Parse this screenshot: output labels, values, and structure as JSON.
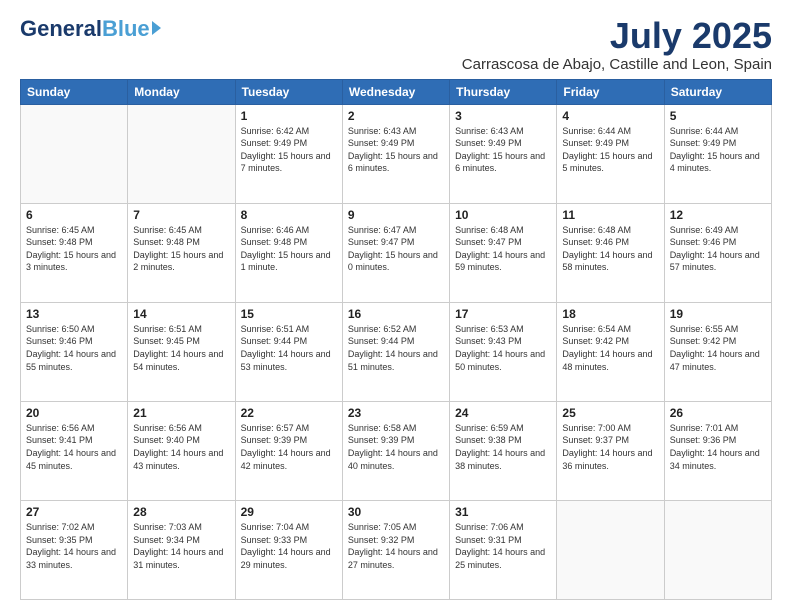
{
  "header": {
    "logo_general": "General",
    "logo_blue": "Blue",
    "main_title": "July 2025",
    "subtitle": "Carrascosa de Abajo, Castille and Leon, Spain"
  },
  "days_of_week": [
    "Sunday",
    "Monday",
    "Tuesday",
    "Wednesday",
    "Thursday",
    "Friday",
    "Saturday"
  ],
  "weeks": [
    [
      {
        "day": "",
        "info": ""
      },
      {
        "day": "",
        "info": ""
      },
      {
        "day": "1",
        "info": "Sunrise: 6:42 AM\nSunset: 9:49 PM\nDaylight: 15 hours and 7 minutes."
      },
      {
        "day": "2",
        "info": "Sunrise: 6:43 AM\nSunset: 9:49 PM\nDaylight: 15 hours and 6 minutes."
      },
      {
        "day": "3",
        "info": "Sunrise: 6:43 AM\nSunset: 9:49 PM\nDaylight: 15 hours and 6 minutes."
      },
      {
        "day": "4",
        "info": "Sunrise: 6:44 AM\nSunset: 9:49 PM\nDaylight: 15 hours and 5 minutes."
      },
      {
        "day": "5",
        "info": "Sunrise: 6:44 AM\nSunset: 9:49 PM\nDaylight: 15 hours and 4 minutes."
      }
    ],
    [
      {
        "day": "6",
        "info": "Sunrise: 6:45 AM\nSunset: 9:48 PM\nDaylight: 15 hours and 3 minutes."
      },
      {
        "day": "7",
        "info": "Sunrise: 6:45 AM\nSunset: 9:48 PM\nDaylight: 15 hours and 2 minutes."
      },
      {
        "day": "8",
        "info": "Sunrise: 6:46 AM\nSunset: 9:48 PM\nDaylight: 15 hours and 1 minute."
      },
      {
        "day": "9",
        "info": "Sunrise: 6:47 AM\nSunset: 9:47 PM\nDaylight: 15 hours and 0 minutes."
      },
      {
        "day": "10",
        "info": "Sunrise: 6:48 AM\nSunset: 9:47 PM\nDaylight: 14 hours and 59 minutes."
      },
      {
        "day": "11",
        "info": "Sunrise: 6:48 AM\nSunset: 9:46 PM\nDaylight: 14 hours and 58 minutes."
      },
      {
        "day": "12",
        "info": "Sunrise: 6:49 AM\nSunset: 9:46 PM\nDaylight: 14 hours and 57 minutes."
      }
    ],
    [
      {
        "day": "13",
        "info": "Sunrise: 6:50 AM\nSunset: 9:46 PM\nDaylight: 14 hours and 55 minutes."
      },
      {
        "day": "14",
        "info": "Sunrise: 6:51 AM\nSunset: 9:45 PM\nDaylight: 14 hours and 54 minutes."
      },
      {
        "day": "15",
        "info": "Sunrise: 6:51 AM\nSunset: 9:44 PM\nDaylight: 14 hours and 53 minutes."
      },
      {
        "day": "16",
        "info": "Sunrise: 6:52 AM\nSunset: 9:44 PM\nDaylight: 14 hours and 51 minutes."
      },
      {
        "day": "17",
        "info": "Sunrise: 6:53 AM\nSunset: 9:43 PM\nDaylight: 14 hours and 50 minutes."
      },
      {
        "day": "18",
        "info": "Sunrise: 6:54 AM\nSunset: 9:42 PM\nDaylight: 14 hours and 48 minutes."
      },
      {
        "day": "19",
        "info": "Sunrise: 6:55 AM\nSunset: 9:42 PM\nDaylight: 14 hours and 47 minutes."
      }
    ],
    [
      {
        "day": "20",
        "info": "Sunrise: 6:56 AM\nSunset: 9:41 PM\nDaylight: 14 hours and 45 minutes."
      },
      {
        "day": "21",
        "info": "Sunrise: 6:56 AM\nSunset: 9:40 PM\nDaylight: 14 hours and 43 minutes."
      },
      {
        "day": "22",
        "info": "Sunrise: 6:57 AM\nSunset: 9:39 PM\nDaylight: 14 hours and 42 minutes."
      },
      {
        "day": "23",
        "info": "Sunrise: 6:58 AM\nSunset: 9:39 PM\nDaylight: 14 hours and 40 minutes."
      },
      {
        "day": "24",
        "info": "Sunrise: 6:59 AM\nSunset: 9:38 PM\nDaylight: 14 hours and 38 minutes."
      },
      {
        "day": "25",
        "info": "Sunrise: 7:00 AM\nSunset: 9:37 PM\nDaylight: 14 hours and 36 minutes."
      },
      {
        "day": "26",
        "info": "Sunrise: 7:01 AM\nSunset: 9:36 PM\nDaylight: 14 hours and 34 minutes."
      }
    ],
    [
      {
        "day": "27",
        "info": "Sunrise: 7:02 AM\nSunset: 9:35 PM\nDaylight: 14 hours and 33 minutes."
      },
      {
        "day": "28",
        "info": "Sunrise: 7:03 AM\nSunset: 9:34 PM\nDaylight: 14 hours and 31 minutes."
      },
      {
        "day": "29",
        "info": "Sunrise: 7:04 AM\nSunset: 9:33 PM\nDaylight: 14 hours and 29 minutes."
      },
      {
        "day": "30",
        "info": "Sunrise: 7:05 AM\nSunset: 9:32 PM\nDaylight: 14 hours and 27 minutes."
      },
      {
        "day": "31",
        "info": "Sunrise: 7:06 AM\nSunset: 9:31 PM\nDaylight: 14 hours and 25 minutes."
      },
      {
        "day": "",
        "info": ""
      },
      {
        "day": "",
        "info": ""
      }
    ]
  ]
}
